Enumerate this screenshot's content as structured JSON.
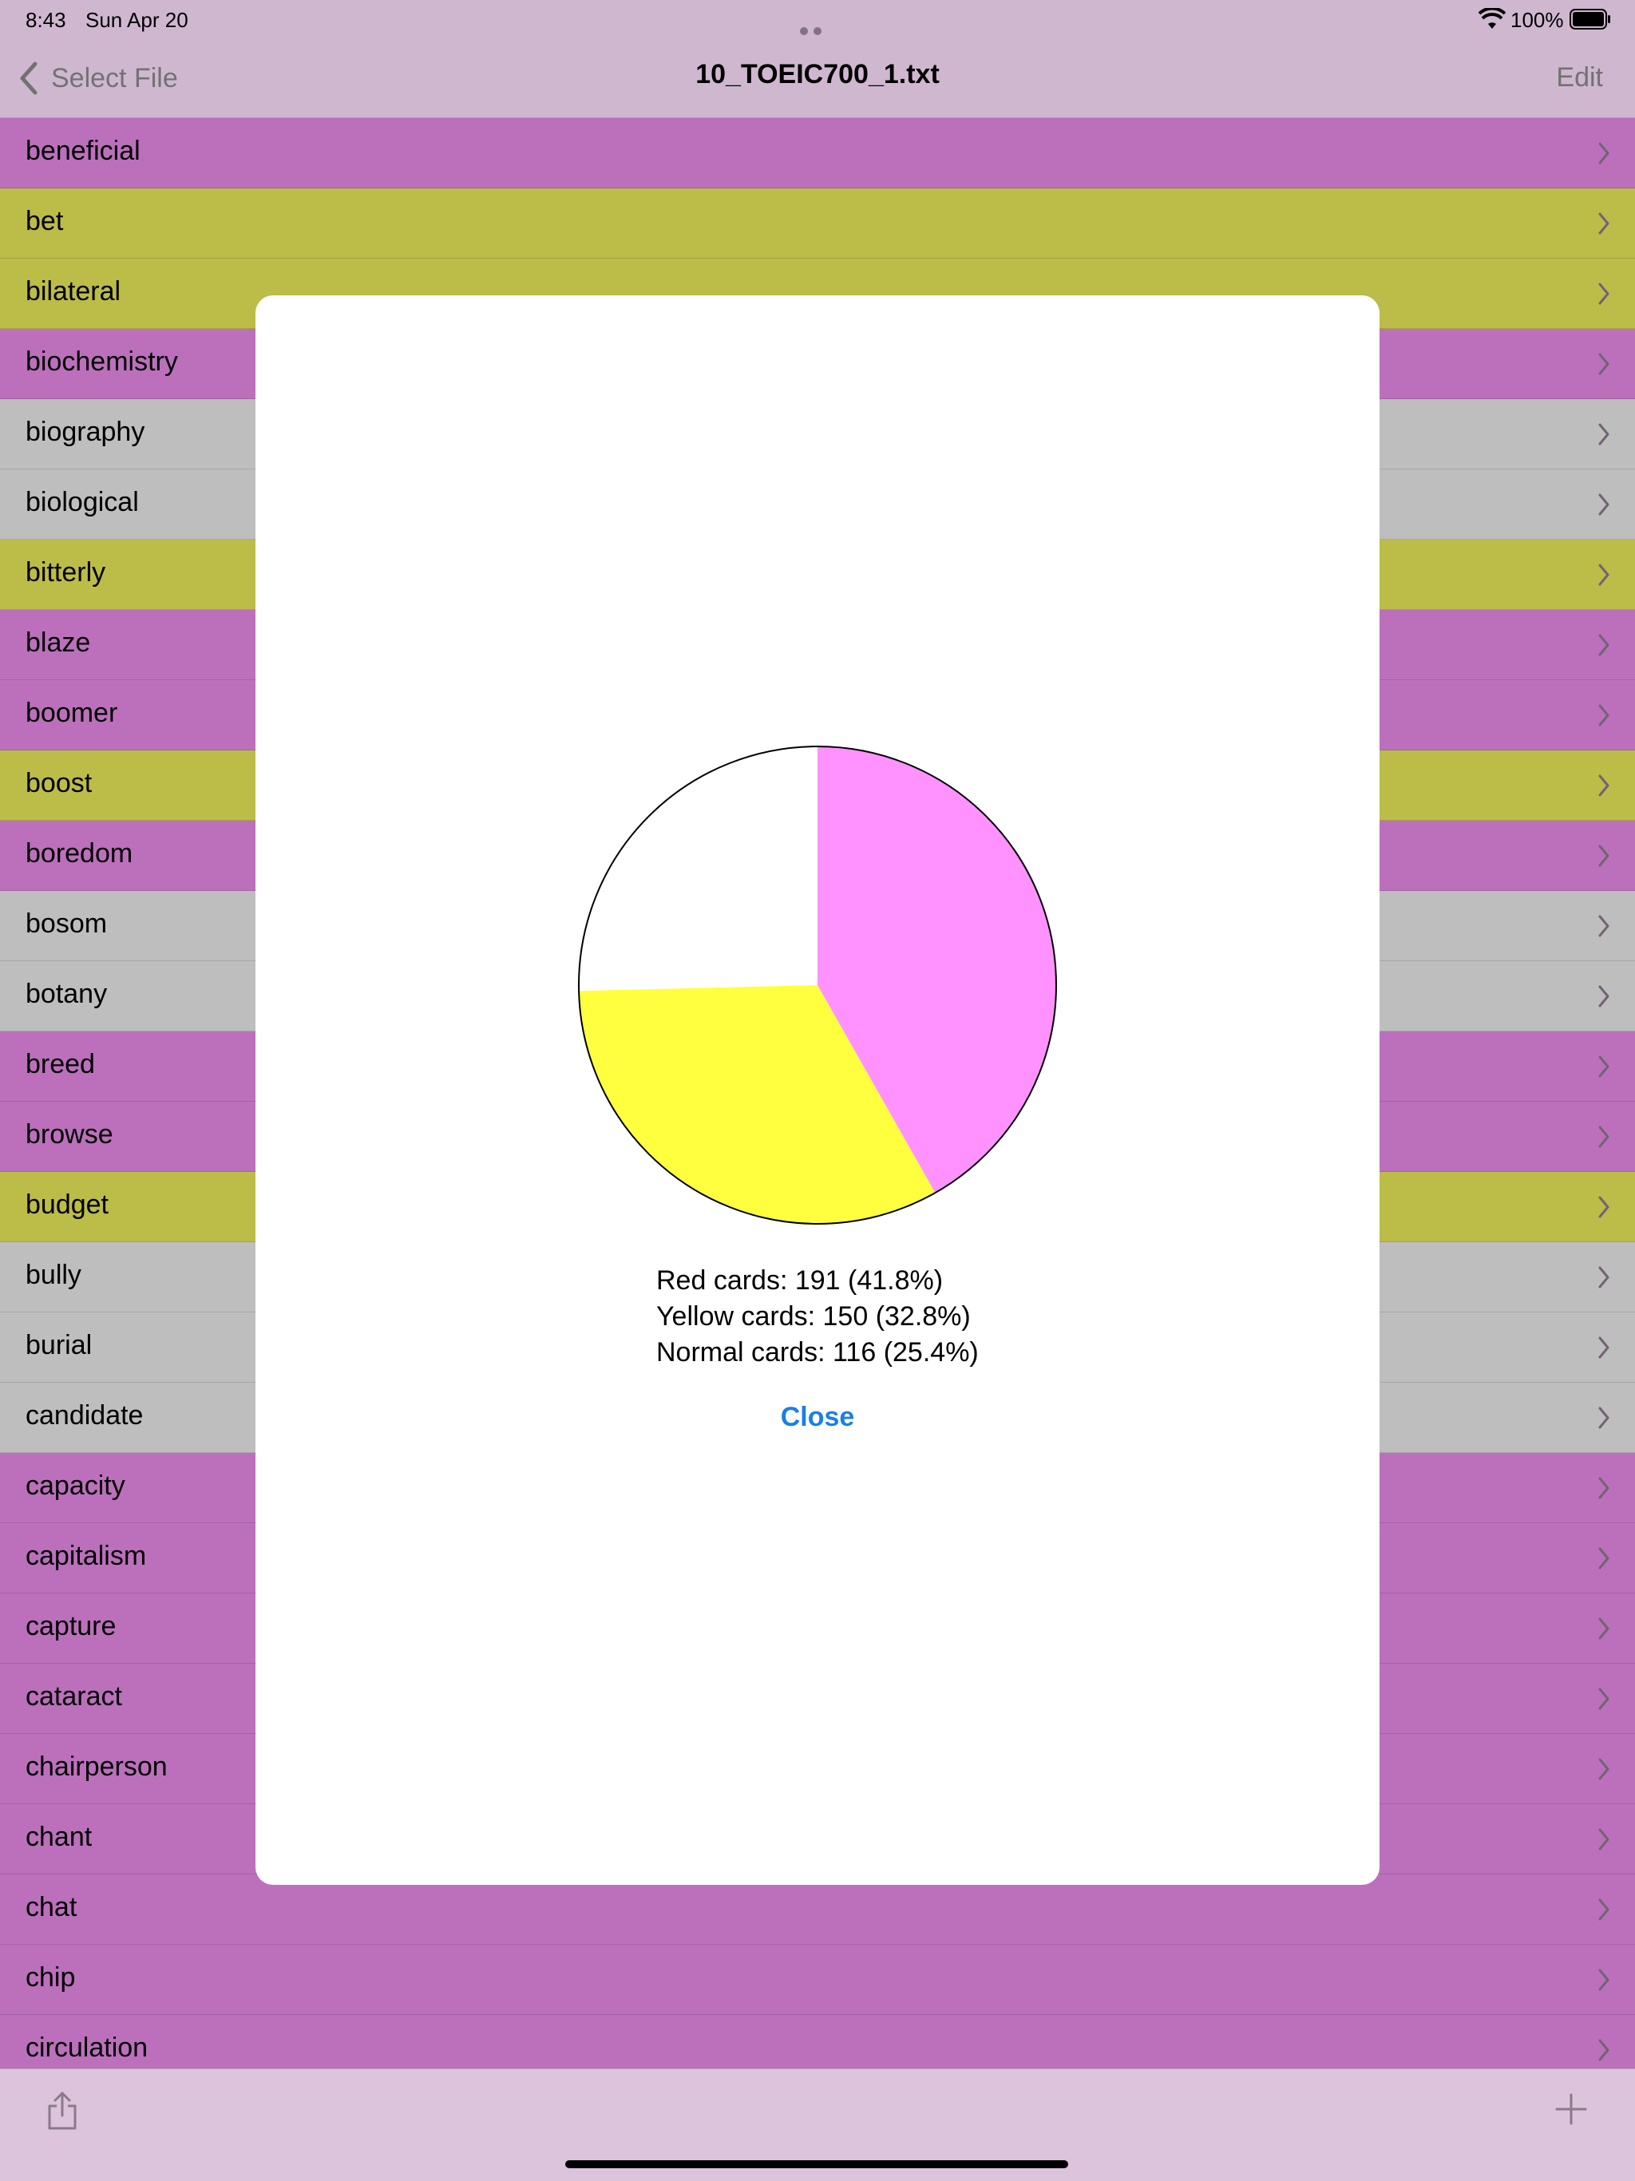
{
  "status_bar": {
    "time": "8:43",
    "date": "Sun Apr 20",
    "battery": "100%"
  },
  "nav": {
    "back_label": "Select File",
    "title": "10_TOEIC700_1.txt",
    "edit_label": "Edit"
  },
  "colors": {
    "red_card": "#c878c8",
    "yellow_card": "#c8c84e",
    "normal_card": "#cacaca",
    "pie_red": "#ff92ff",
    "pie_yellow": "#ffff40",
    "pie_normal": "#ffffff",
    "link": "#1a7fe8"
  },
  "words": [
    {
      "word": "beneficial",
      "status": "red"
    },
    {
      "word": "bet",
      "status": "yellow"
    },
    {
      "word": "bilateral",
      "status": "yellow"
    },
    {
      "word": "biochemistry",
      "status": "red"
    },
    {
      "word": "biography",
      "status": "normal"
    },
    {
      "word": "biological",
      "status": "normal"
    },
    {
      "word": "bitterly",
      "status": "yellow"
    },
    {
      "word": "blaze",
      "status": "red"
    },
    {
      "word": "boomer",
      "status": "red"
    },
    {
      "word": "boost",
      "status": "yellow"
    },
    {
      "word": "boredom",
      "status": "red"
    },
    {
      "word": "bosom",
      "status": "normal"
    },
    {
      "word": "botany",
      "status": "normal"
    },
    {
      "word": "breed",
      "status": "red"
    },
    {
      "word": "browse",
      "status": "red"
    },
    {
      "word": "budget",
      "status": "yellow"
    },
    {
      "word": "bully",
      "status": "normal"
    },
    {
      "word": "burial",
      "status": "normal"
    },
    {
      "word": "candidate",
      "status": "normal"
    },
    {
      "word": "capacity",
      "status": "red"
    },
    {
      "word": "capitalism",
      "status": "red"
    },
    {
      "word": "capture",
      "status": "red"
    },
    {
      "word": "cataract",
      "status": "red"
    },
    {
      "word": "chairperson",
      "status": "red"
    },
    {
      "word": "chant",
      "status": "red"
    },
    {
      "word": "chat",
      "status": "red"
    },
    {
      "word": "chip",
      "status": "red"
    },
    {
      "word": "circulation",
      "status": "red"
    }
  ],
  "modal": {
    "stats": [
      "Red cards: 191 (41.8%)",
      "Yellow cards: 150 (32.8%)",
      "Normal cards: 116 (25.4%)"
    ],
    "close_label": "Close"
  },
  "chart_data": {
    "type": "pie",
    "labels": [
      "Red cards",
      "Yellow cards",
      "Normal cards"
    ],
    "values": [
      191,
      150,
      116
    ],
    "percentages": [
      41.8,
      32.8,
      25.4
    ],
    "colors": [
      "#ff92ff",
      "#ffff40",
      "#ffffff"
    ],
    "start": "12 o'clock",
    "direction": "clockwise"
  }
}
